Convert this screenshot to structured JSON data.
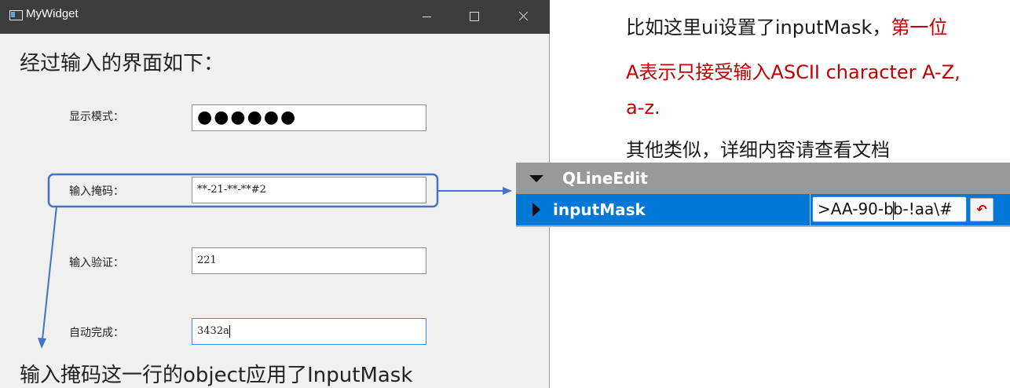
{
  "window": {
    "title": "MyWidget",
    "caption_top": "经过输入的界面如下：",
    "caption_bottom": "输入掩码这一行的object应用了InputMask",
    "fields": [
      {
        "label": "显示模式：",
        "value": "●●●●●●"
      },
      {
        "label": "输入掩码：",
        "value": "**-21-**-**#2"
      },
      {
        "label": "输入验证：",
        "value": "221"
      },
      {
        "label": "自动完成：",
        "value": "3432a"
      }
    ]
  },
  "note": {
    "line1_black": "比如这里ui设置了inputMask，",
    "line1_red": "第一位",
    "line2": "A表示只接受输入ASCII character A-Z,",
    "line3": "a-z.",
    "line4": "其他类似，详细内容请查看文档"
  },
  "property_editor": {
    "group": "QLineEdit",
    "property": "inputMask",
    "value_before_caret": ">AA-90-b",
    "value_after_caret": "b-!aa\\#"
  },
  "colors": {
    "annotation": "#4472c4",
    "highlight": "#0078d7",
    "emphasis": "#c00000"
  }
}
